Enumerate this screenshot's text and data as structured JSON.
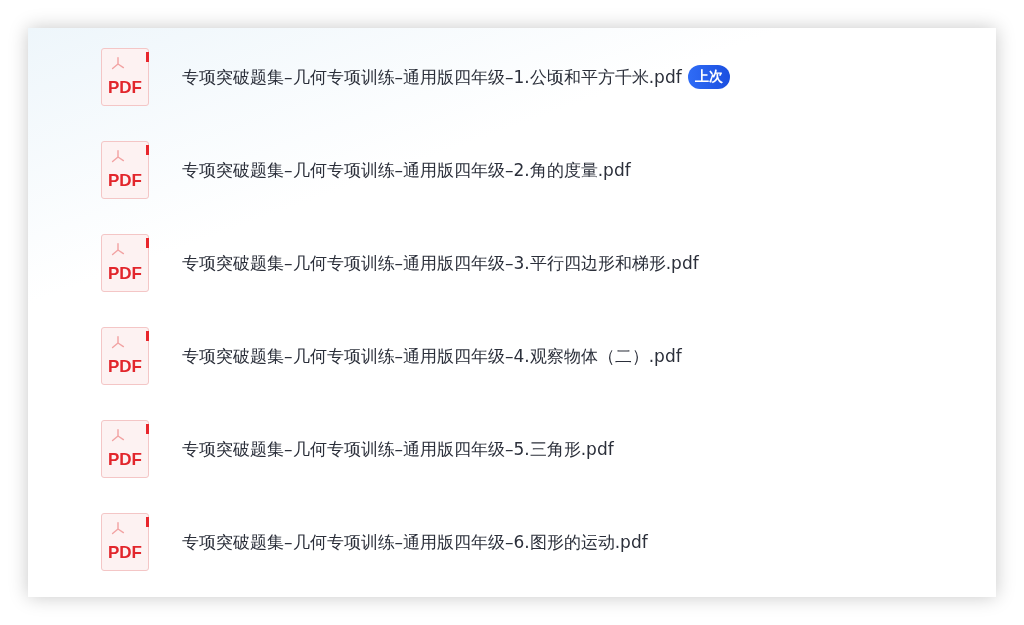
{
  "files": [
    {
      "icon_label": "PDF",
      "name": "专项突破题集–几何专项训练–通用版四年级–1.公顷和平方千米.pdf",
      "badge": "上次"
    },
    {
      "icon_label": "PDF",
      "name": "专项突破题集–几何专项训练–通用版四年级–2.角的度量.pdf"
    },
    {
      "icon_label": "PDF",
      "name": "专项突破题集–几何专项训练–通用版四年级–3.平行四边形和梯形.pdf"
    },
    {
      "icon_label": "PDF",
      "name": "专项突破题集–几何专项训练–通用版四年级–4.观察物体（二）.pdf"
    },
    {
      "icon_label": "PDF",
      "name": "专项突破题集–几何专项训练–通用版四年级–5.三角形.pdf"
    },
    {
      "icon_label": "PDF",
      "name": "专项突破题集–几何专项训练–通用版四年级–6.图形的运动.pdf"
    }
  ]
}
